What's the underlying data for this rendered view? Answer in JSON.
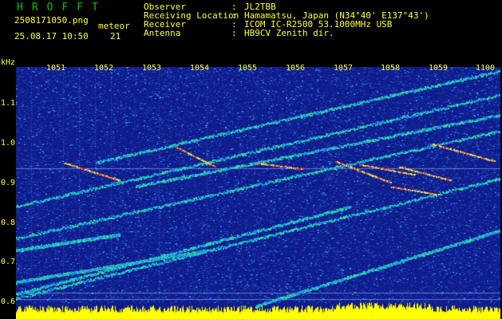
{
  "header": {
    "title": "HROFFT",
    "filename": "2508171050.png",
    "datetime": "25.08.17 10:50",
    "meteor_label": "meteor",
    "meteor_count": "21"
  },
  "info": [
    {
      "key": "Observer",
      "value": "JL2TBB"
    },
    {
      "key": "Receiving Location",
      "value": "Hamamatsu, Japan (N34°40' E137°43')"
    },
    {
      "key": "Receiver",
      "value": "ICOM IC-R2500 53.1000MHz USB"
    },
    {
      "key": "Antenna",
      "value": "HB9CV Zenith dir."
    }
  ],
  "spectrogram": {
    "y_unit": "kHz",
    "y_ticks": [
      "1.1",
      "1.0",
      "0.9",
      "0.8",
      "0.7",
      "0.6"
    ],
    "x_ticks": [
      "1051",
      "1052",
      "1053",
      "1054",
      "1055",
      "1056",
      "1057",
      "1058",
      "1059",
      "1100"
    ],
    "colors": {
      "background": "#101c8c",
      "noise": "#1e50d0",
      "trace": "#30d8a0",
      "hot": "#e03030",
      "amplitude": "#ffff00",
      "text": "#ffff33",
      "title": "#00c000"
    }
  }
}
